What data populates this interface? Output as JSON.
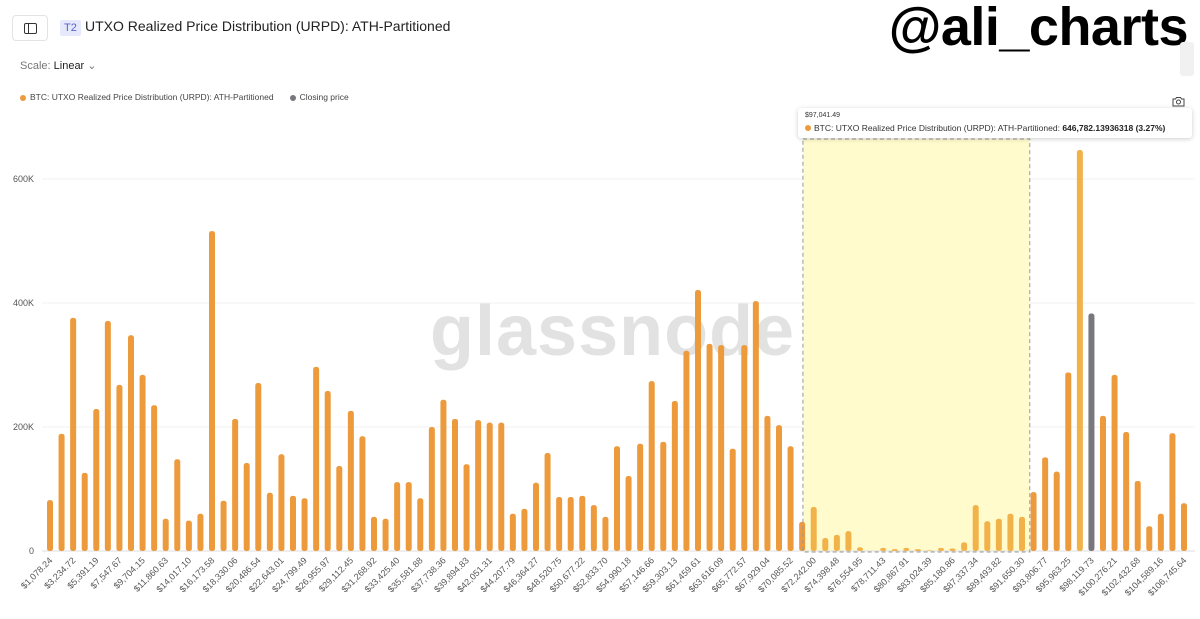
{
  "header": {
    "tier_badge": "T2",
    "title": "UTXO Realized Price Distribution (URPD): ATH-Partitioned",
    "scale_label": "Scale:",
    "scale_value": "Linear",
    "brand": "@ali_charts"
  },
  "watermark": "glassnode",
  "legend": [
    {
      "label": "BTC: UTXO Realized Price Distribution (URPD): ATH-Partitioned",
      "color": "#ec9a3c"
    },
    {
      "label": "Closing price",
      "color": "#77777d"
    }
  ],
  "tooltip": {
    "date": "$97,041.49",
    "series": "BTC: UTXO Realized Price Distribution (URPD): ATH-Partitioned:",
    "value": "646,782.13936318 (3.27%)"
  },
  "chart_data": {
    "type": "bar",
    "ylim": [
      0,
      680000
    ],
    "y_ticks": [
      "0",
      "200K",
      "400K",
      "600K"
    ],
    "y_tick_values": [
      0,
      200000,
      400000,
      600000
    ],
    "grid": true,
    "x_tick_labels": [
      "$1,078.24",
      "$3,234.72",
      "$5,391.19",
      "$7,547.67",
      "$9,704.15",
      "$11,860.63",
      "$14,017.10",
      "$16,173.58",
      "$18,330.06",
      "$20,486.54",
      "$22,643.01",
      "$24,799.49",
      "$26,955.97",
      "$29,112.45",
      "$31,268.92",
      "$33,425.40",
      "$35,581.88",
      "$37,738.36",
      "$39,894.83",
      "$42,051.31",
      "$44,207.79",
      "$46,364.27",
      "$48,520.75",
      "$50,677.22",
      "$52,833.70",
      "$54,990.18",
      "$57,146.66",
      "$59,303.13",
      "$61,459.61",
      "$63,616.09",
      "$65,772.57",
      "$67,929.04",
      "$70,085.52",
      "$72,242.00",
      "$74,398.48",
      "$76,554.95",
      "$78,711.43",
      "$80,867.91",
      "$83,024.39",
      "$85,180.86",
      "$87,337.34",
      "$89,493.82",
      "$91,650.30",
      "$93,806.77",
      "$95,963.25",
      "$98,119.73",
      "$100,276.21",
      "$102,432.68",
      "$104,589.16",
      "$106,745.64"
    ],
    "values": [
      82000,
      189000,
      376000,
      126000,
      229000,
      371000,
      268000,
      348000,
      284000,
      235000,
      52000,
      148000,
      49000,
      60000,
      516000,
      81000,
      213000,
      142000,
      271000,
      94000,
      156000,
      89000,
      85000,
      297000,
      258000,
      137000,
      226000,
      185000,
      55000,
      52000,
      111000,
      111000,
      85000,
      200000,
      244000,
      213000,
      140000,
      211000,
      207000,
      207000,
      60000,
      68000,
      110000,
      158000,
      87000,
      87000,
      89000,
      74000,
      55000,
      169000,
      121000,
      173000,
      274000,
      176000,
      242000,
      323000,
      421000,
      334000,
      332000,
      165000,
      332000,
      403000,
      218000,
      203000,
      169000,
      47000,
      71000,
      21000,
      26000,
      32000,
      6000,
      0,
      5000,
      3000,
      5000,
      3000,
      1000,
      5000,
      4000,
      14000,
      74000,
      48000,
      52000,
      60000,
      55000,
      95000,
      151000,
      128000,
      288000,
      646782.14,
      383000,
      218000,
      284000,
      192000,
      113000,
      40000,
      60000,
      190000,
      77000
    ],
    "closing_price_bar": "$98,119.73",
    "hovered_bar": "$97,041.49",
    "highlight_range": [
      "$72,242.00",
      "$91,650.30"
    ],
    "colors": {
      "bar": "#ec9a3c",
      "highlighted_bar": "#f2b24a",
      "closing": "#77777d",
      "highlight_fill": "#fffbcc"
    }
  }
}
